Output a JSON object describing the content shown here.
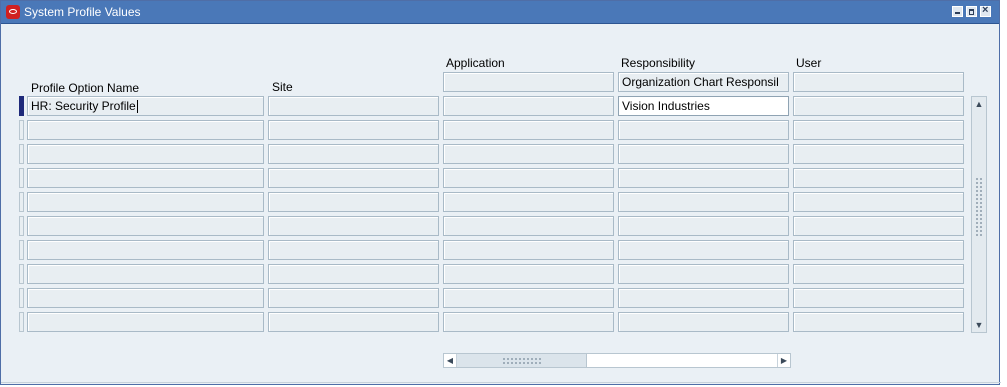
{
  "window": {
    "title": "System Profile Values"
  },
  "columns": {
    "profile_option_name": "Profile Option Name",
    "site": "Site",
    "application": "Application",
    "responsibility": "Responsibility",
    "user": "User"
  },
  "context": {
    "application": "",
    "responsibility": "Organization Chart Responsil",
    "user": ""
  },
  "rows": [
    {
      "profile_option_name": "HR: Security Profile",
      "site": "",
      "application": "",
      "responsibility": "Vision Industries",
      "user": ""
    },
    {
      "profile_option_name": "",
      "site": "",
      "application": "",
      "responsibility": "",
      "user": ""
    },
    {
      "profile_option_name": "",
      "site": "",
      "application": "",
      "responsibility": "",
      "user": ""
    },
    {
      "profile_option_name": "",
      "site": "",
      "application": "",
      "responsibility": "",
      "user": ""
    },
    {
      "profile_option_name": "",
      "site": "",
      "application": "",
      "responsibility": "",
      "user": ""
    },
    {
      "profile_option_name": "",
      "site": "",
      "application": "",
      "responsibility": "",
      "user": ""
    },
    {
      "profile_option_name": "",
      "site": "",
      "application": "",
      "responsibility": "",
      "user": ""
    },
    {
      "profile_option_name": "",
      "site": "",
      "application": "",
      "responsibility": "",
      "user": ""
    },
    {
      "profile_option_name": "",
      "site": "",
      "application": "",
      "responsibility": "",
      "user": ""
    },
    {
      "profile_option_name": "",
      "site": "",
      "application": "",
      "responsibility": "",
      "user": ""
    }
  ],
  "icons": {
    "app_icon": "oracle-logo-icon",
    "scroll_up": "arrow-up-icon",
    "scroll_down": "arrow-down-icon",
    "scroll_left": "arrow-left-icon",
    "scroll_right": "arrow-right-icon"
  },
  "colors": {
    "titlebar": "#4a78b8",
    "field_bg": "#e8eef2",
    "active_field_bg": "#ffffff",
    "current_row_indicator": "#1f2a7a"
  }
}
